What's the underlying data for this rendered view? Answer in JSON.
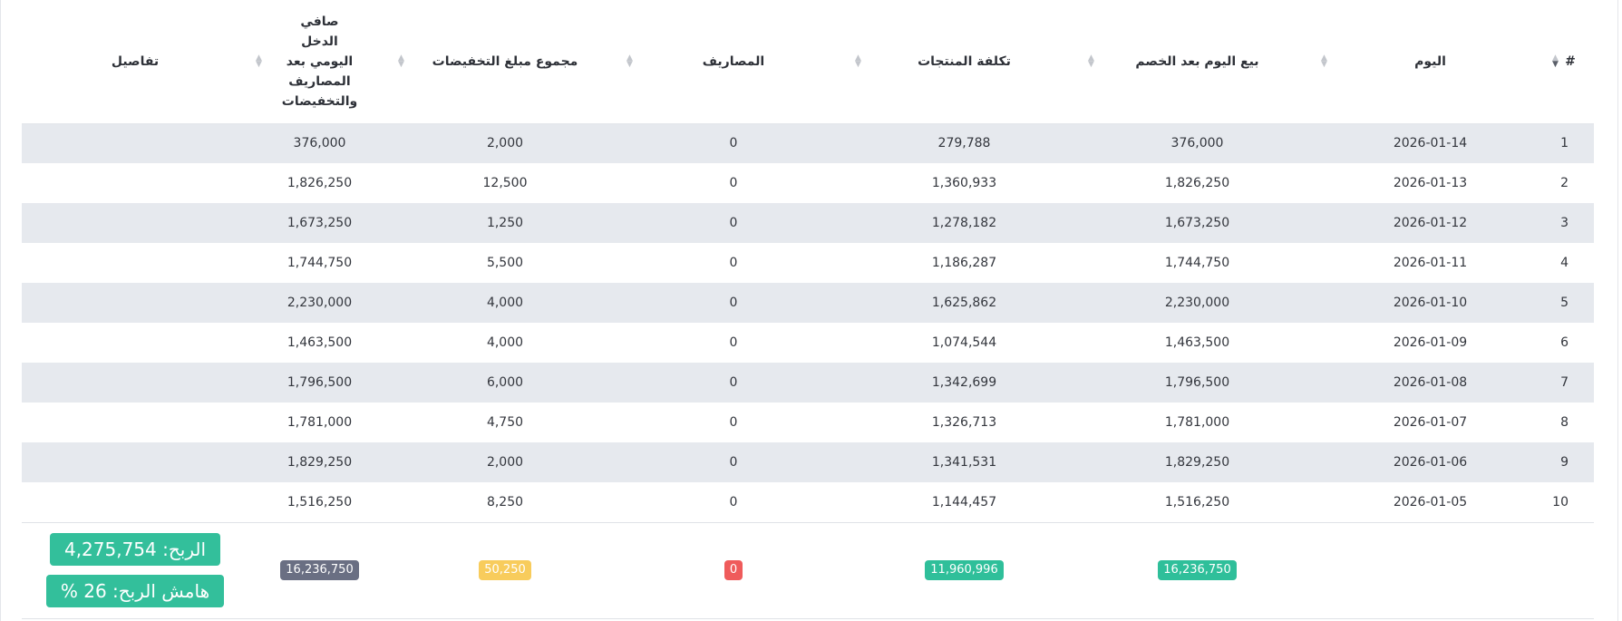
{
  "table": {
    "headers": {
      "num": "#",
      "day": "اليوم",
      "sales_after_discount": "بيع اليوم بعد الخصم",
      "products_cost": "تكلفة المنتجات",
      "expenses": "المصاريف",
      "discounts_total": "مجموع مبلغ التخفيضات",
      "net_income_lines": [
        "صافي",
        "الدخل",
        "اليومي بعد",
        "المصاريف",
        "والتخفيضات"
      ],
      "details": "تفاصيل"
    },
    "rows": [
      {
        "num": "1",
        "day": "2026-01-14",
        "sales": "376,000",
        "cost": "279,788",
        "expenses": "0",
        "discounts": "2,000",
        "net": "376,000"
      },
      {
        "num": "2",
        "day": "2026-01-13",
        "sales": "1,826,250",
        "cost": "1,360,933",
        "expenses": "0",
        "discounts": "12,500",
        "net": "1,826,250"
      },
      {
        "num": "3",
        "day": "2026-01-12",
        "sales": "1,673,250",
        "cost": "1,278,182",
        "expenses": "0",
        "discounts": "1,250",
        "net": "1,673,250"
      },
      {
        "num": "4",
        "day": "2026-01-11",
        "sales": "1,744,750",
        "cost": "1,186,287",
        "expenses": "0",
        "discounts": "5,500",
        "net": "1,744,750"
      },
      {
        "num": "5",
        "day": "2026-01-10",
        "sales": "2,230,000",
        "cost": "1,625,862",
        "expenses": "0",
        "discounts": "4,000",
        "net": "2,230,000"
      },
      {
        "num": "6",
        "day": "2026-01-09",
        "sales": "1,463,500",
        "cost": "1,074,544",
        "expenses": "0",
        "discounts": "4,000",
        "net": "1,463,500"
      },
      {
        "num": "7",
        "day": "2026-01-08",
        "sales": "1,796,500",
        "cost": "1,342,699",
        "expenses": "0",
        "discounts": "6,000",
        "net": "1,796,500"
      },
      {
        "num": "8",
        "day": "2026-01-07",
        "sales": "1,781,000",
        "cost": "1,326,713",
        "expenses": "0",
        "discounts": "4,750",
        "net": "1,781,000"
      },
      {
        "num": "9",
        "day": "2026-01-06",
        "sales": "1,829,250",
        "cost": "1,341,531",
        "expenses": "0",
        "discounts": "2,000",
        "net": "1,829,250"
      },
      {
        "num": "10",
        "day": "2026-01-05",
        "sales": "1,516,250",
        "cost": "1,144,457",
        "expenses": "0",
        "discounts": "8,250",
        "net": "1,516,250"
      }
    ],
    "totals": {
      "sales": "16,236,750",
      "cost": "11,960,996",
      "expenses": "0",
      "discounts": "50,250",
      "net": "16,236,750",
      "profit_label": "الربح: 4,275,754",
      "margin_label": "هامش الربح: 26 %"
    }
  },
  "colors": {
    "row_stripe": "#e6e9ee",
    "badge_teal": "#2fbf9a",
    "badge_red": "#ef5b5b",
    "badge_yellow": "#f8cc5c",
    "badge_slate": "#6a6f83"
  },
  "icons": {
    "sort": "sort-both-icon",
    "sort_active": "sort-desc-icon"
  }
}
